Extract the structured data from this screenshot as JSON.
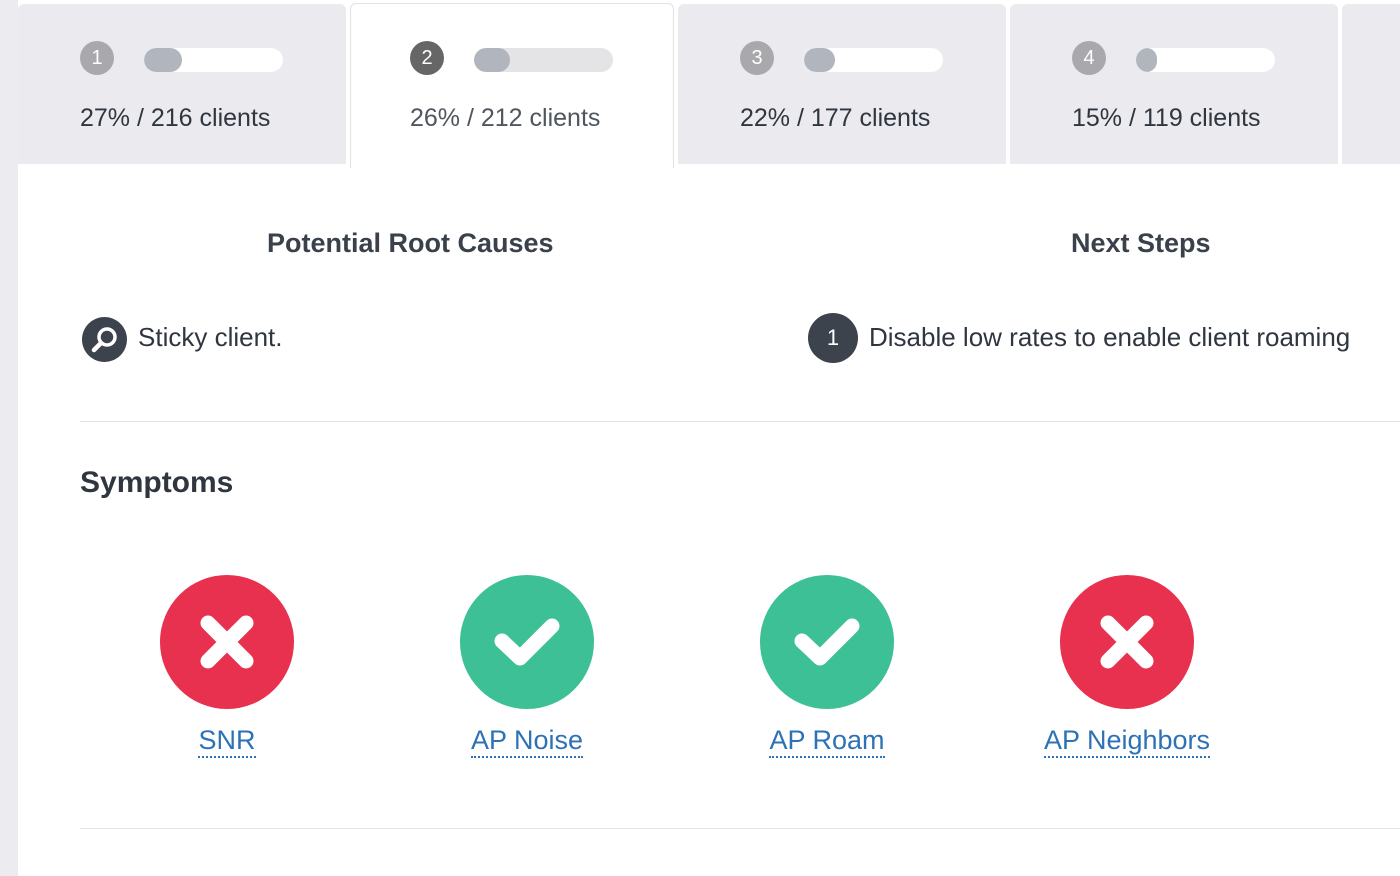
{
  "colors": {
    "fail": "#e8304f",
    "pass": "#3dc096",
    "link": "#2d72b6",
    "dark": "#3d434d"
  },
  "tabs": [
    {
      "number": "1",
      "label": "27% / 216 clients",
      "percent": 27,
      "active": false
    },
    {
      "number": "2",
      "label": "26% / 212 clients",
      "percent": 26,
      "active": true
    },
    {
      "number": "3",
      "label": "22% / 177 clients",
      "percent": 22,
      "active": false
    },
    {
      "number": "4",
      "label": "15% / 119 clients",
      "percent": 15,
      "active": false
    }
  ],
  "root_causes": {
    "title": "Potential Root Causes",
    "items": [
      {
        "icon": "magnify-icon",
        "text": "Sticky client."
      }
    ]
  },
  "next_steps": {
    "title": "Next Steps",
    "items": [
      {
        "number": "1",
        "text": "Disable low rates to enable client roaming"
      }
    ]
  },
  "symptoms": {
    "title": "Symptoms",
    "items": [
      {
        "label": "SNR",
        "status": "fail",
        "icon": "x-icon"
      },
      {
        "label": "AP Noise",
        "status": "pass",
        "icon": "check-icon"
      },
      {
        "label": "AP Roam",
        "status": "pass",
        "icon": "check-icon"
      },
      {
        "label": "AP Neighbors",
        "status": "fail",
        "icon": "x-icon"
      }
    ]
  }
}
